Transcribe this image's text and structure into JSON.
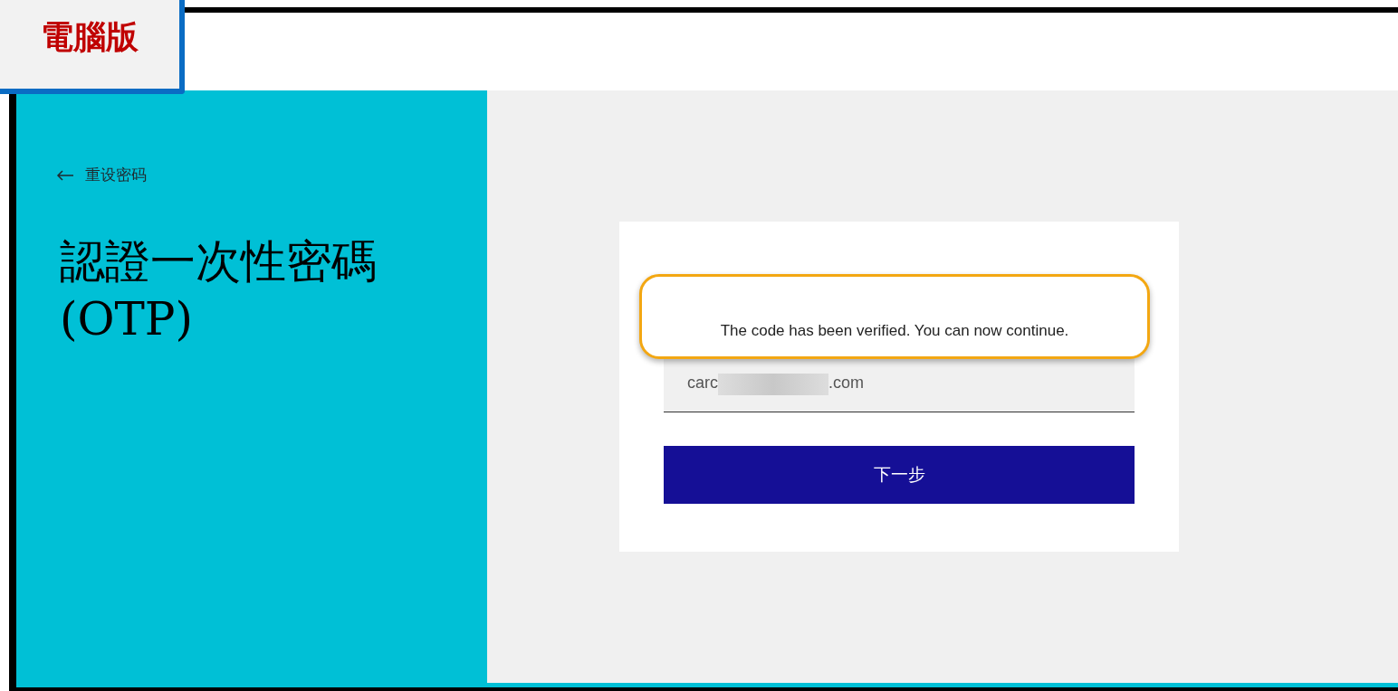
{
  "badge": {
    "label": "電腦版"
  },
  "sidebar": {
    "back_link": {
      "label": "重设密码"
    },
    "title": "認證一次性密碼 (OTP)"
  },
  "card": {
    "message": "The code has been verified. You can now continue.",
    "email_field": {
      "value_start": "carc",
      "value_end": ".com"
    },
    "next_button": {
      "label": "下一步"
    }
  }
}
